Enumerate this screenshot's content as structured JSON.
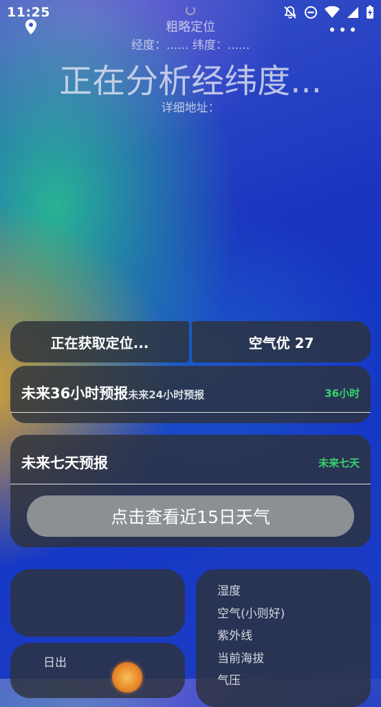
{
  "status_bar": {
    "time": "11:25"
  },
  "header": {
    "location_type": "粗略定位",
    "latlng": "经度：...... 纬度：......",
    "analyzing": "正在分析经纬度...",
    "address": "详细地址："
  },
  "quick_buttons": {
    "locating": "正在获取定位...",
    "air_quality": "空气优 27"
  },
  "forecast_36h": {
    "title": "未来36小时预报",
    "subtitle": "未来24小时预报",
    "tag": "36小时"
  },
  "forecast_7d": {
    "title": "未来七天预报",
    "tag": "未来七天",
    "button_15d": "点击查看近15日天气"
  },
  "sun_card": {
    "label": "日出"
  },
  "detail_list": [
    "湿度",
    "空气(小则好)",
    "紫外线",
    "当前海拔",
    "气压"
  ],
  "colors": {
    "accent_green": "#35d46a",
    "card_bg": "#2d323a"
  }
}
